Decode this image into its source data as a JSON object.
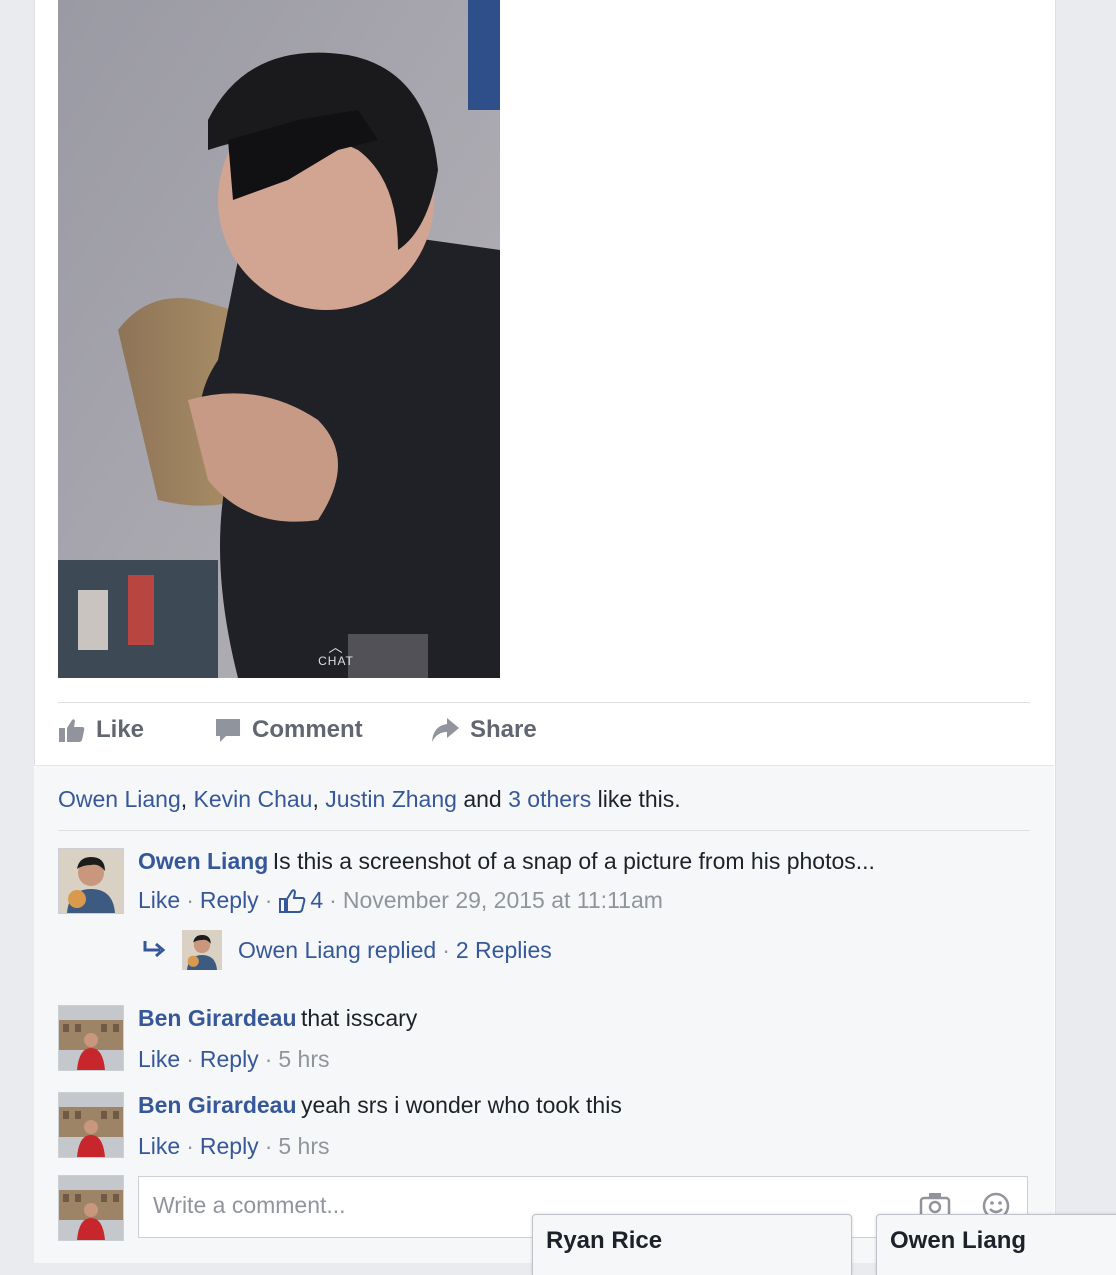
{
  "post": {
    "photo_overlay": {
      "chat_label": "CHAT"
    },
    "actions": {
      "like": "Like",
      "comment": "Comment",
      "share": "Share"
    }
  },
  "likes": {
    "names": [
      "Owen Liang",
      "Kevin Chau",
      "Justin Zhang"
    ],
    "sep1": ", ",
    "sep2": ", ",
    "and_text": " and ",
    "others": "3 others",
    "suffix": " like this."
  },
  "comments": [
    {
      "author": "Owen Liang",
      "text": "Is this a screenshot of a snap of a picture from his photos...",
      "like": "Like",
      "reply": "Reply",
      "reactions": "4",
      "time": "November 29, 2015 at 11:11am",
      "replies": {
        "author_text": "Owen Liang replied",
        "count_text": "2 Replies"
      }
    },
    {
      "author": "Ben Girardeau",
      "text": "that isscary",
      "like": "Like",
      "reply": "Reply",
      "time": "5 hrs"
    },
    {
      "author": "Ben Girardeau",
      "text": "yeah srs i wonder who took this",
      "like": "Like",
      "reply": "Reply",
      "time": "5 hrs"
    }
  ],
  "composer": {
    "placeholder": "Write a comment..."
  },
  "chat_windows": [
    "Ryan Rice",
    "Owen Liang"
  ],
  "colors": {
    "link": "#365899",
    "muted": "#90949c",
    "action": "#606770",
    "feedback_bg": "#f6f7f9"
  }
}
